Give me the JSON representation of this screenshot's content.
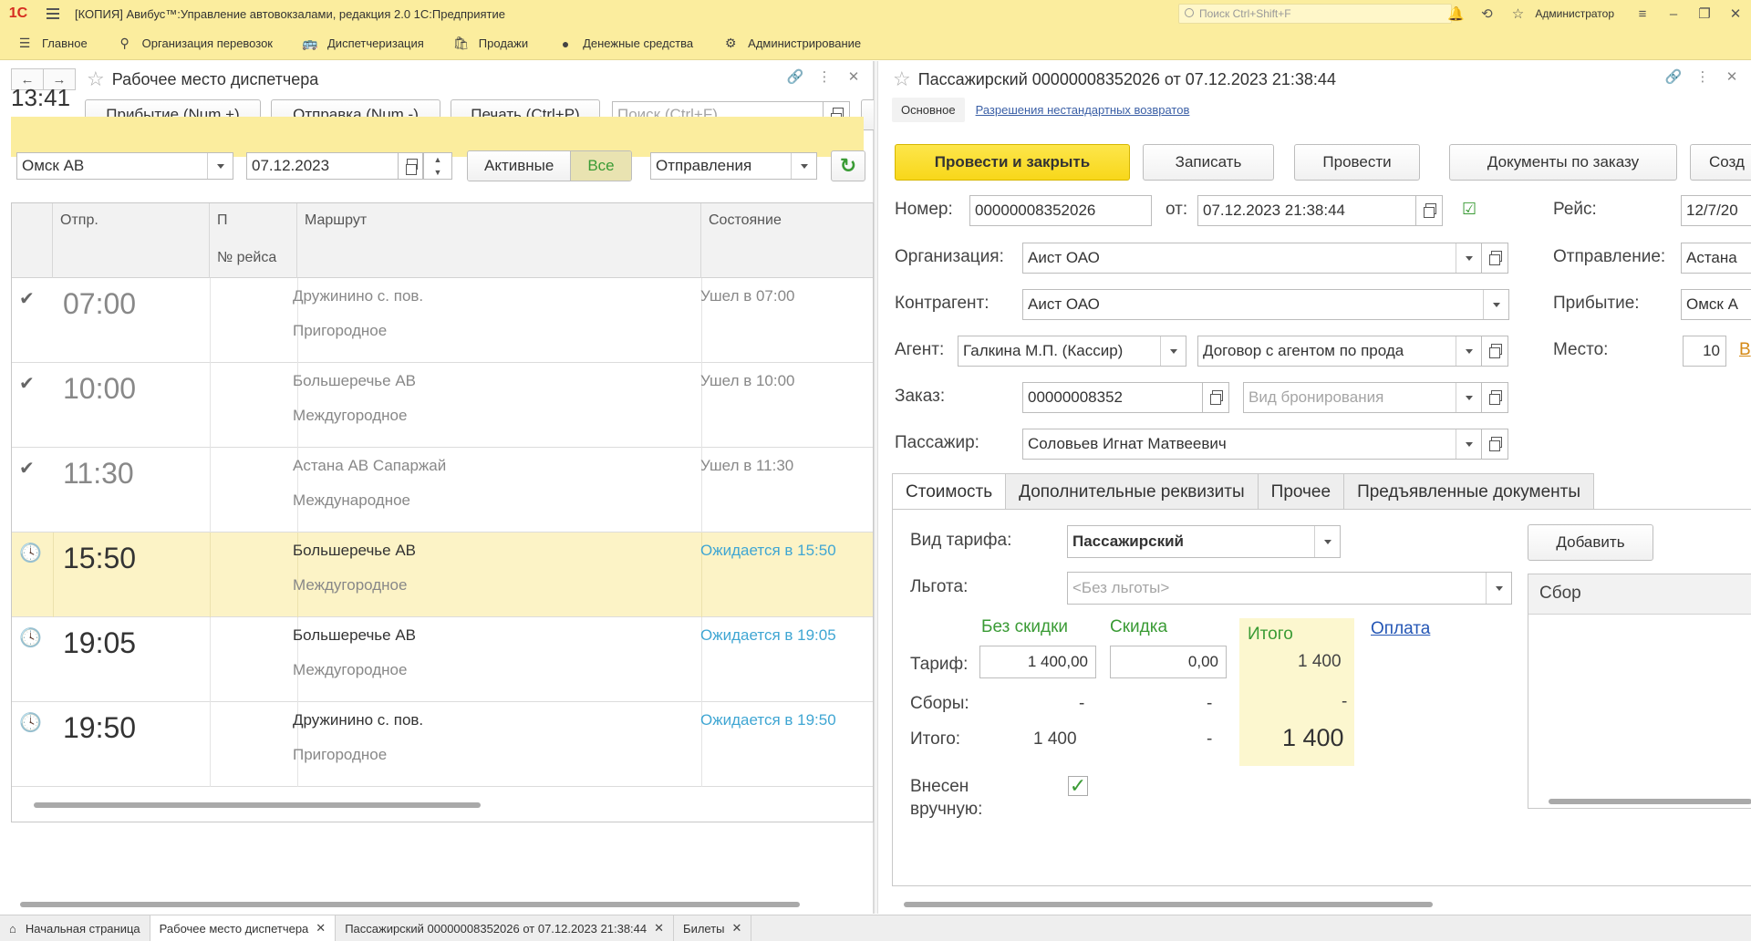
{
  "titlebar": {
    "logo": "1С",
    "title": "[КОПИЯ] Авибус™:Управление автовокзалами, редакция 2.0 1С:Предприятие",
    "search_placeholder": "Поиск Ctrl+Shift+F",
    "user": "Администратор"
  },
  "menu": [
    {
      "label": "Главное",
      "icon": "hamburger-icon"
    },
    {
      "label": "Организация перевозок",
      "icon": "map-pin-icon"
    },
    {
      "label": "Диспетчеризация",
      "icon": "bus-icon"
    },
    {
      "label": "Продажи",
      "icon": "bag-icon"
    },
    {
      "label": "Денежные средства",
      "icon": "coin-icon"
    },
    {
      "label": "Администрирование",
      "icon": "gear-icon"
    }
  ],
  "left": {
    "title": "Рабочее место диспетчера",
    "clock": "13:41",
    "buttons": {
      "arrival": "Прибытие (Num +)",
      "departure": "Отправка (Num -)",
      "print": "Печать (Ctrl+P)"
    },
    "search_placeholder": "Поиск (Ctrl+F)",
    "filter": {
      "station": "Омск АВ",
      "date": "07.12.2023",
      "seg_active": "Активные",
      "seg_all": "Все",
      "mode": "Отправления"
    },
    "columns": {
      "dep": "Отпр.",
      "p": "П",
      "trip_no": "№ рейса",
      "route": "Маршрут",
      "state": "Состояние"
    },
    "rows": [
      {
        "mark": "✔",
        "time": "07:00",
        "route": "Дружинино с. пов.",
        "type": "Пригородное",
        "state": "Ушел в 07:00",
        "active": false,
        "selected": false
      },
      {
        "mark": "✔",
        "time": "10:00",
        "route": "Большеречье АВ",
        "type": "Междугородное",
        "state": "Ушел в 10:00",
        "active": false,
        "selected": false
      },
      {
        "mark": "✔",
        "time": "11:30",
        "route": "Астана АВ Сапаржай",
        "type": "Международное",
        "state": "Ушел в 11:30",
        "active": false,
        "selected": false
      },
      {
        "mark": "🕓",
        "time": "15:50",
        "route": "Большеречье АВ",
        "type": "Междугородное",
        "state": "Ожидается в 15:50",
        "active": true,
        "selected": true
      },
      {
        "mark": "🕓",
        "time": "19:05",
        "route": "Большеречье АВ",
        "type": "Междугородное",
        "state": "Ожидается в 19:05",
        "active": true,
        "selected": false
      },
      {
        "mark": "🕓",
        "time": "19:50",
        "route": "Дружинино с. пов.",
        "type": "Пригородное",
        "state": "Ожидается в 19:50",
        "active": true,
        "selected": false
      }
    ]
  },
  "right": {
    "title": "Пассажирский 00000008352026 от 07.12.2023 21:38:44",
    "tab_main": "Основное",
    "tab_link": "Разрешения нестандартных возвратов",
    "buttons": {
      "post_close": "Провести и закрыть",
      "save": "Записать",
      "post": "Провести",
      "order_docs": "Документы по заказу",
      "create": "Созд"
    },
    "fields": {
      "number_label": "Номер:",
      "number": "00000008352026",
      "from_label": "от:",
      "from": "07.12.2023 21:38:44",
      "trip_label": "Рейс:",
      "trip": "12/7/20",
      "org_label": "Организация:",
      "org": "Аист ОАО",
      "departure_label": "Отправление:",
      "departure": "Астана",
      "contr_label": "Контрагент:",
      "contr": "Аист ОАО",
      "arrival_label": "Прибытие:",
      "arrival": "Омск А",
      "agent_label": "Агент:",
      "agent": "Галкина М.П. (Кассир)",
      "contract": "Договор с агентом по прода",
      "seat_label": "Место:",
      "seat": "10",
      "seat_link": "В",
      "order_label": "Заказ:",
      "order": "00000008352",
      "booking_placeholder": "Вид бронирования",
      "passenger_label": "Пассажир:",
      "passenger": "Соловьев Игнат Матвеевич"
    },
    "tabs": [
      "Стоимость",
      "Дополнительные реквизиты",
      "Прочее",
      "Предъявленные документы"
    ],
    "cost": {
      "tariff_type_label": "Вид тарифа:",
      "tariff_type": "Пассажирский",
      "benefit_label": "Льгота:",
      "benefit_placeholder": "<Без льготы>",
      "no_discount": "Без скидки",
      "discount": "Скидка",
      "total_head": "Итого",
      "payment": "Оплата",
      "tariff_label": "Тариф:",
      "tariff_value": "1 400,00",
      "discount_value": "0,00",
      "tariff_total": "1 400",
      "fees_label": "Сборы:",
      "fees_nd": "-",
      "fees_d": "-",
      "fees_total": "-",
      "total_label": "Итого:",
      "total_nd": "1 400",
      "total_d": "-",
      "total_total": "1 400",
      "manual_label1": "Внесен",
      "manual_label2": "вручную:",
      "add_button": "Добавить",
      "fee_column": "Сбор"
    }
  },
  "taskbar": [
    {
      "label": "Начальная страница",
      "closable": false
    },
    {
      "label": "Рабочее место диспетчера",
      "closable": true
    },
    {
      "label": "Пассажирский 00000008352026 от 07.12.2023 21:38:44",
      "closable": true
    },
    {
      "label": "Билеты",
      "closable": true
    }
  ]
}
